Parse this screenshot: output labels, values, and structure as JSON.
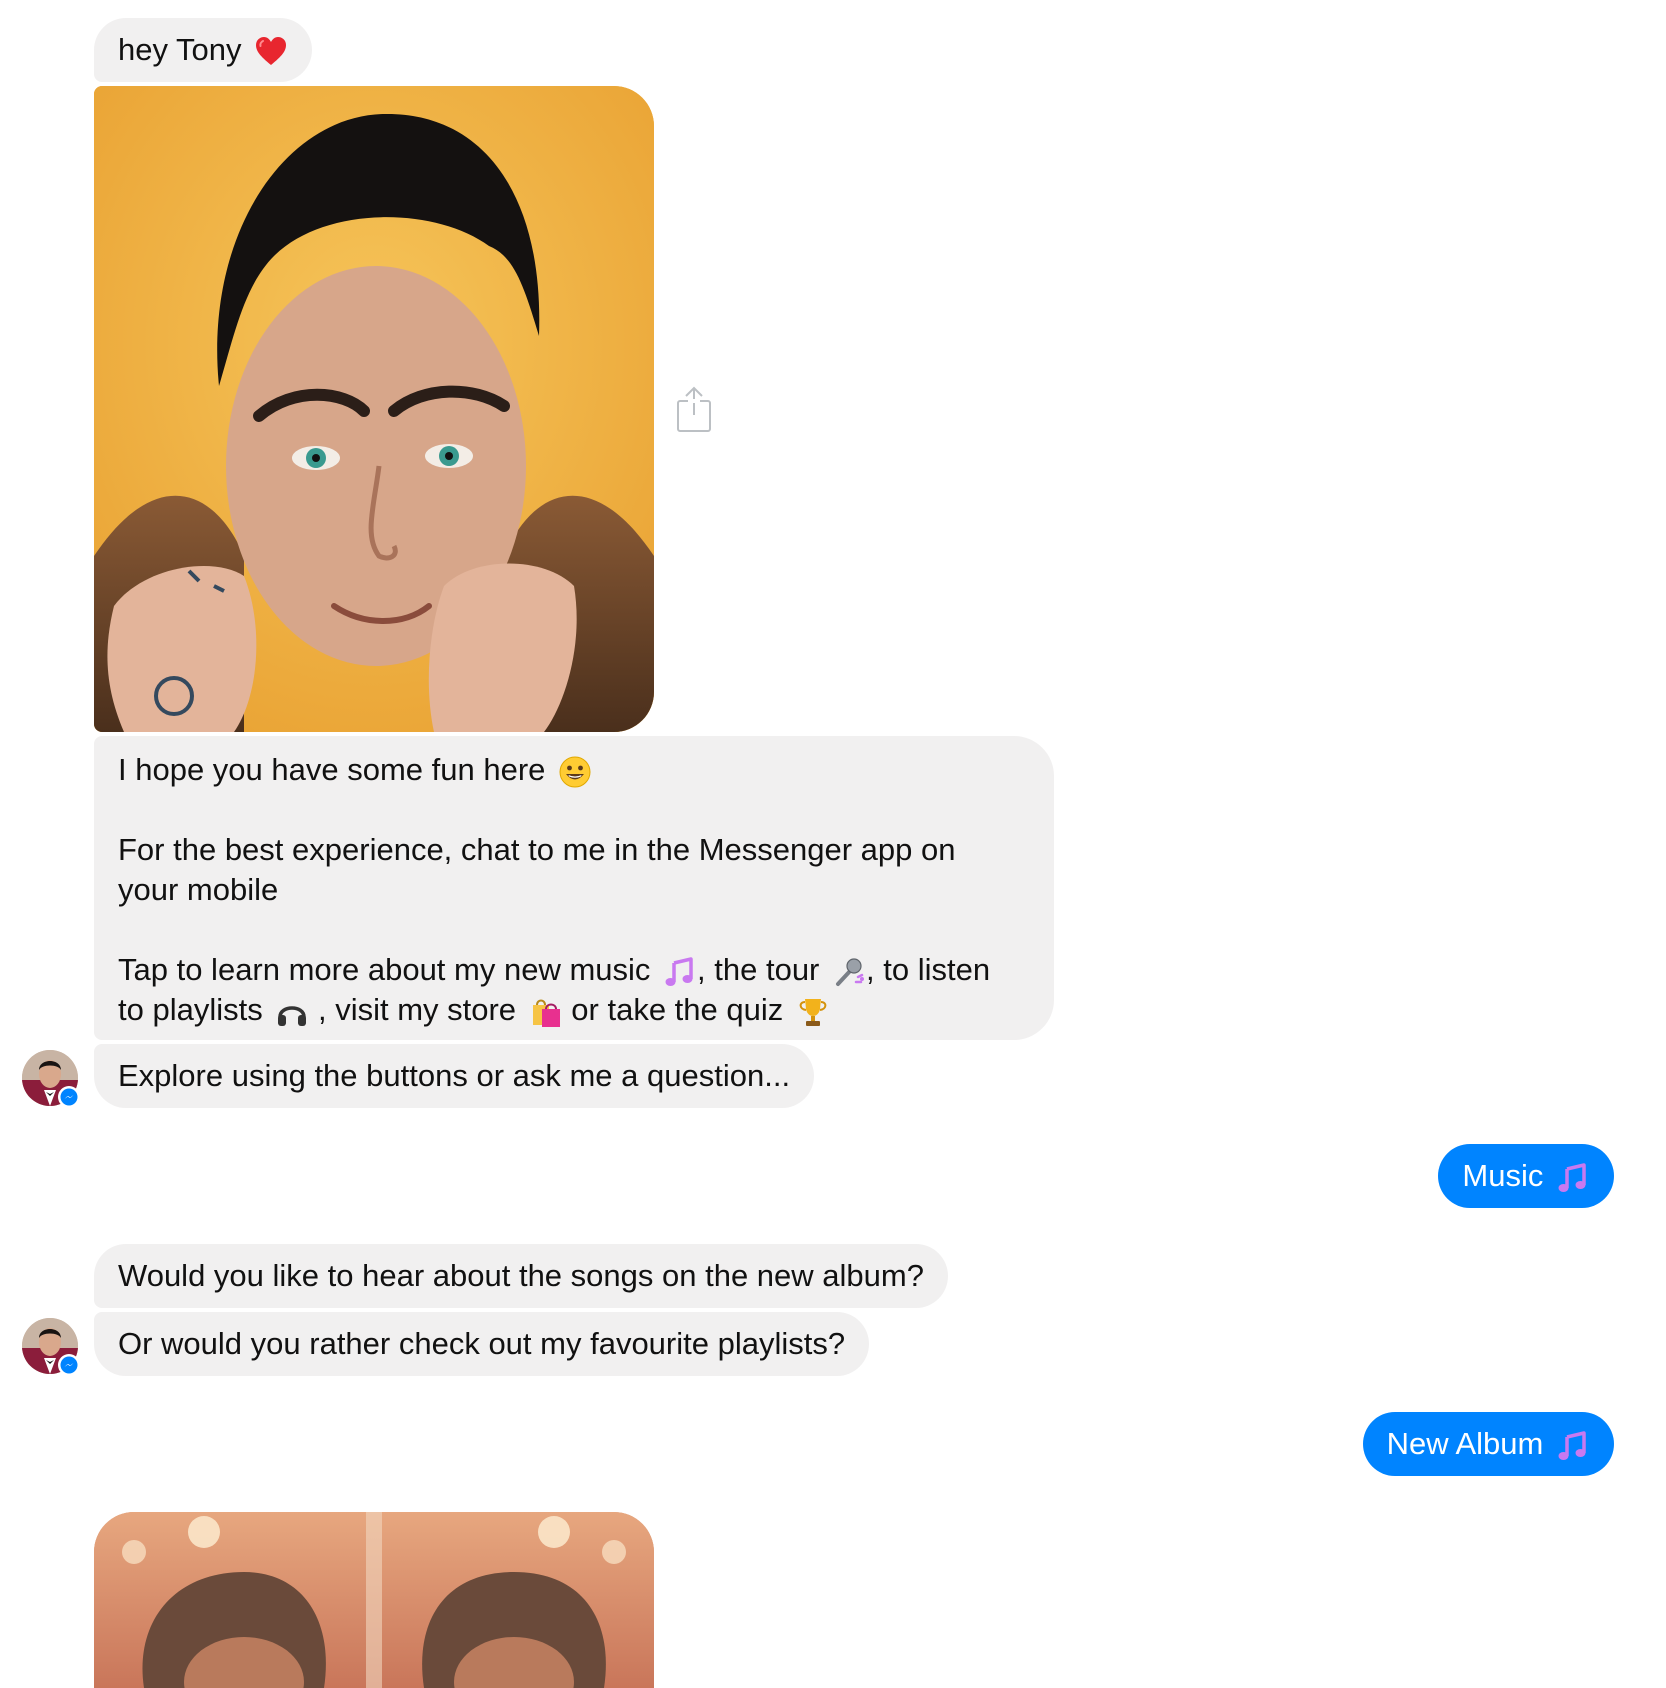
{
  "conversation": {
    "messages": [
      {
        "from": "bot",
        "text": "hey Tony",
        "emoji": "red-heart"
      },
      {
        "from": "bot",
        "type": "image",
        "alt": ""
      },
      {
        "from": "bot",
        "line1": "I hope you have some fun here",
        "line1_emoji": "grinning-face",
        "line2": "For the best experience, chat to me in the Messenger app on",
        "line3": "your mobile",
        "line4_a": "Tap to learn more about my new music",
        "line4_b": ", the tour",
        "line4_c": ",  to listen",
        "line5_a": "to playlists",
        "line5_b": " , visit my store",
        "line5_c": " or take the quiz"
      },
      {
        "from": "bot",
        "text": "Explore using the buttons or ask me a question..."
      },
      {
        "from": "user",
        "text": "Music",
        "emoji": "musical-note"
      },
      {
        "from": "bot",
        "text": "Would you like to hear about the songs on the new album?"
      },
      {
        "from": "bot",
        "text": "Or would you rather check out my favourite playlists?"
      },
      {
        "from": "user",
        "text": "New Album",
        "emoji": "musical-note"
      },
      {
        "from": "bot",
        "type": "image",
        "alt": ""
      }
    ]
  },
  "colors": {
    "bot_bubble": "#f1f0f0",
    "user_bubble": "#0084ff",
    "messenger_badge": "#0084ff"
  }
}
